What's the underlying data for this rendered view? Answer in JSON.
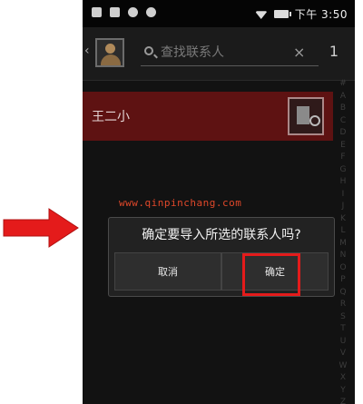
{
  "status_bar": {
    "time": "下午 3:50"
  },
  "header": {
    "search_placeholder": "查找联系人",
    "clear_icon": "×",
    "count": "1"
  },
  "contact": {
    "name": "王二小"
  },
  "index_letters": [
    "#",
    "A",
    "B",
    "C",
    "D",
    "E",
    "F",
    "G",
    "H",
    "I",
    "J",
    "K",
    "L",
    "M",
    "N",
    "O",
    "P",
    "Q",
    "R",
    "S",
    "T",
    "U",
    "V",
    "W",
    "X",
    "Y",
    "Z"
  ],
  "watermark": "www.qinpinchang.com",
  "dialog": {
    "message": "确定要导入所选的联系人吗?",
    "cancel": "取消",
    "confirm": "确定"
  },
  "colors": {
    "accent_red": "#e41b1b",
    "selected_row": "#5e1212",
    "background": "#121212"
  }
}
